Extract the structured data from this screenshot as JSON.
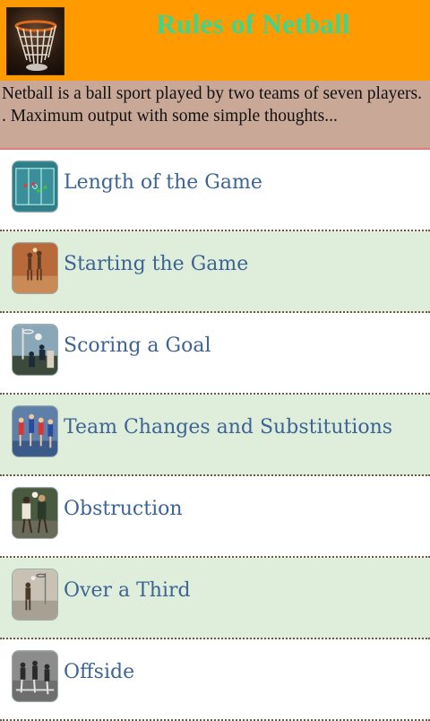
{
  "header": {
    "title": "Rules of Netball",
    "logo_icon": "basketball-hoop-icon",
    "background": "#ff9a00",
    "title_color": "#3dd68c"
  },
  "intro": {
    "text": "Netball is a ball sport played by two teams of seven players. . Maximum output with some simple thoughts..."
  },
  "menu": {
    "items": [
      {
        "label": "Length of the Game",
        "icon": "court-diagram-icon"
      },
      {
        "label": "Starting the Game",
        "icon": "players-photo-icon"
      },
      {
        "label": "Scoring a Goal",
        "icon": "goal-shot-photo-icon"
      },
      {
        "label": "Team Changes and Substitutions",
        "icon": "team-photo-icon"
      },
      {
        "label": "Obstruction",
        "icon": "obstruction-photo-icon"
      },
      {
        "label": "Over a Third",
        "icon": "over-third-photo-icon"
      },
      {
        "label": "Offside",
        "icon": "offside-photo-icon"
      }
    ],
    "colors": {
      "alt_row": "#deeedb",
      "label": "#3e6493"
    }
  }
}
